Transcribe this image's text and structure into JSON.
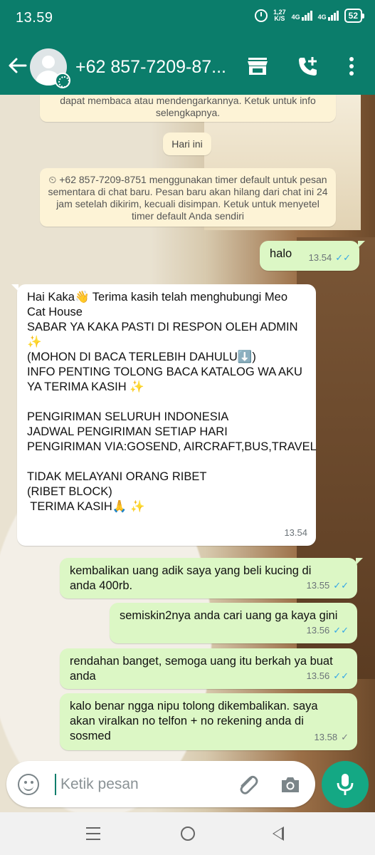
{
  "status_bar": {
    "time": "13.59",
    "speed_value": "1,27",
    "speed_unit": "K/S",
    "network_1": "4G",
    "network_2": "4G",
    "battery": "52"
  },
  "header": {
    "contact_name": "+62 857-7209-87...",
    "background_color": "#0b7d6b"
  },
  "chat": {
    "encryption_notice": [
      "dapat membaca atau mendengarkannya. Ketuk untuk info",
      "selengkapnya."
    ],
    "date_chip": "Hari ini",
    "timer_notice": [
      "⏲ +62 857-7209-8751 menggunakan timer default untuk pesan",
      "sementara di chat baru. Pesan baru akan hilang dari chat ini 24",
      "jam setelah dikirim, kecuali disimpan. Ketuk untuk menyetel",
      "timer default Anda sendiri"
    ],
    "messages": [
      {
        "direction": "out",
        "lines": [
          "halo"
        ],
        "time": "13.54",
        "status": "read"
      },
      {
        "direction": "in",
        "lines": [
          "Hai Kaka👋 Terima kasih telah menghubungi Meo",
          "Cat House",
          "SABAR YA KAKA PASTI DI RESPON OLEH ADMIN",
          "✨",
          "(MOHON DI BACA TERLEBIH DAHULU⬇️)",
          "INFO PENTING TOLONG BACA KATALOG WA AKU",
          "YA TERIMA KASIH ✨",
          "",
          "PENGIRIMAN SELURUH INDONESIA",
          "JADWAL PENGIRIMAN SETIAP HARI",
          "PENGIRIMAN VIA:GOSEND, AIRCRAFT,BUS,TRAVEL",
          "",
          "TIDAK MELAYANI ORANG RIBET",
          "(RIBET BLOCK)",
          " TERIMA KASIH🙏 ✨"
        ],
        "time": "13.54"
      },
      {
        "direction": "out",
        "lines": [
          "kembalikan uang adik saya yang beli kucing di",
          "anda 400rb."
        ],
        "time": "13.55",
        "status": "read"
      },
      {
        "direction": "out",
        "lines": [
          "semiskin2nya anda cari uang ga kaya gini"
        ],
        "time": "13.56",
        "status": "read"
      },
      {
        "direction": "out",
        "lines": [
          "rendahan banget, semoga uang itu berkah ya buat",
          "anda"
        ],
        "time": "13.56",
        "status": "read"
      },
      {
        "direction": "out",
        "lines": [
          "kalo benar ngga nipu tolong dikembalikan. saya",
          "akan viralkan no telfon + no rekening anda di",
          "sosmed"
        ],
        "time": "13.58",
        "status": "sent"
      }
    ]
  },
  "composer": {
    "placeholder": "Ketik pesan",
    "emoji_icon": "emoji-icon",
    "attach_icon": "paperclip-icon",
    "camera_icon": "camera-icon",
    "mic_icon": "microphone-icon",
    "mic_color": "#14a884"
  },
  "nav": {
    "recent": "recent-apps-icon",
    "home": "home-icon",
    "back": "back-icon"
  }
}
